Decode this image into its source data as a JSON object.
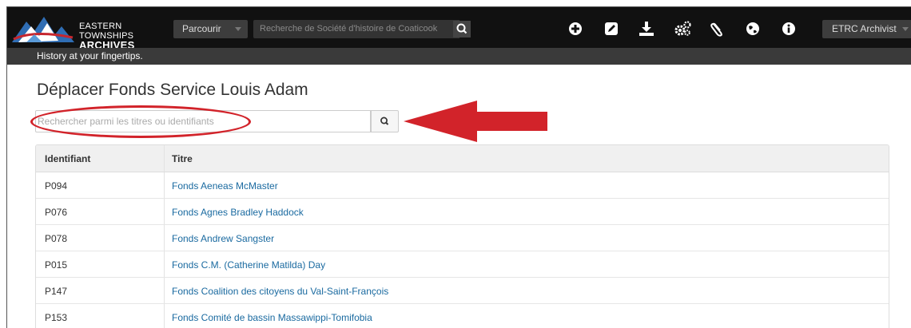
{
  "header": {
    "logo": {
      "line1": "EASTERN TOWNSHIPS",
      "line2": "ARCHIVES PORTAL",
      "icon": "archives-portal-logo-icon"
    },
    "browse_label": "Parcourir",
    "search_placeholder": "Recherche de Société d'histoire de Coaticook",
    "tools": [
      {
        "name": "add-icon",
        "glyph": "plus-circle"
      },
      {
        "name": "edit-icon",
        "glyph": "pencil-square"
      },
      {
        "name": "import-icon",
        "glyph": "download"
      },
      {
        "name": "settings-icon",
        "glyph": "gears"
      },
      {
        "name": "clipboard-icon",
        "glyph": "paperclip"
      },
      {
        "name": "language-icon",
        "glyph": "globe"
      },
      {
        "name": "info-icon",
        "glyph": "info-circle"
      }
    ],
    "user_label": "ETRC Archivist"
  },
  "tagline": "History at your fingertips.",
  "page": {
    "title": "Déplacer Fonds Service Louis Adam",
    "search_placeholder": "Rechercher parmi les titres ou identifiants"
  },
  "table": {
    "headers": {
      "id": "Identifiant",
      "title": "Titre"
    },
    "rows": [
      {
        "id": "P094",
        "title": "Fonds Aeneas McMaster"
      },
      {
        "id": "P076",
        "title": "Fonds Agnes Bradley Haddock"
      },
      {
        "id": "P078",
        "title": "Fonds Andrew Sangster"
      },
      {
        "id": "P015",
        "title": "Fonds C.M. (Catherine Matilda) Day"
      },
      {
        "id": "P147",
        "title": "Fonds Coalition des citoyens du Val-Saint-François"
      },
      {
        "id": "P153",
        "title": "Fonds Comité de bassin Massawippi-Tomifobia"
      }
    ]
  },
  "colors": {
    "topbar": "#111111",
    "tagline_bar": "#3a3a3a",
    "link": "#1a6aa0",
    "annotation_red": "#d2232a"
  }
}
